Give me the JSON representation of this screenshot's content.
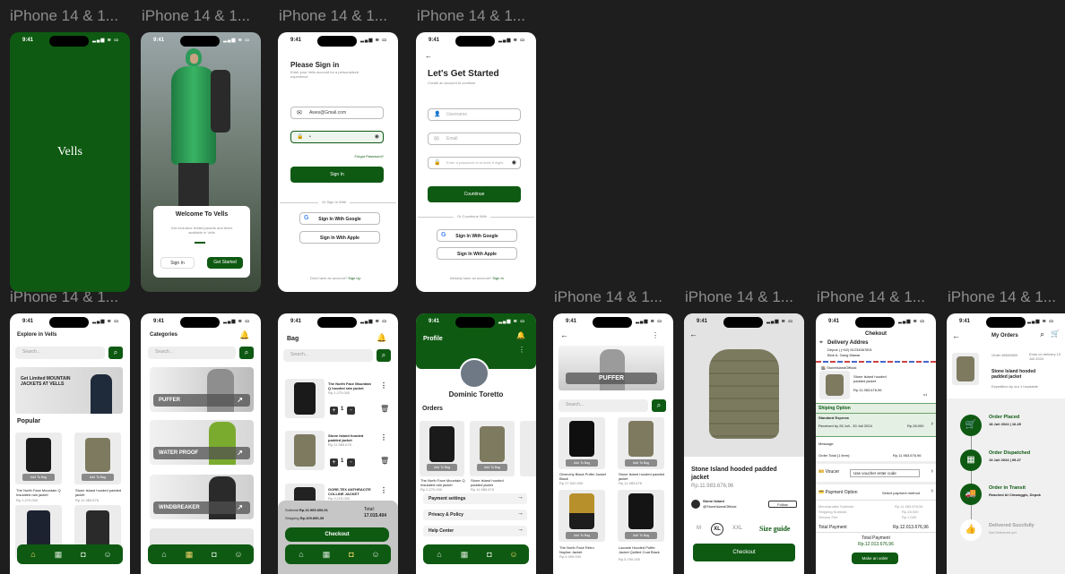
{
  "frame_label": "iPhone 14 & 1...",
  "status_time": "9:41",
  "status_icons": "▂▄▆ ≋ ▭",
  "splash": {
    "brand": "Vells"
  },
  "welcome": {
    "title": "Welcome To Vells",
    "subtitle": "Get exclusive limited jackets and items available in Vells",
    "sign_in": "Sign In",
    "get_started": "Get Started"
  },
  "signin": {
    "title": "Please Sign in",
    "subtitle": "Enter your Vells account for a personalized experience",
    "email": "Awes@Gmail.com",
    "password": "•",
    "forgot": "Forgot Password?",
    "button": "Sign In",
    "divider": "Or Sign In With",
    "google": "Sign In With Google",
    "apple": "Sign In With Apple",
    "footer": "Dont have an account?",
    "footer_link": "Sign Up"
  },
  "signup": {
    "title": "Let's Get Started",
    "subtitle": "Create an account to continue",
    "username": "Username",
    "email": "Email",
    "password": "Enter a password of at least 8 digits",
    "button": "Countinue",
    "divider": "Or Countinue With",
    "google": "Sign In With Google",
    "apple": "Sign In With Apple",
    "footer": "Already have an account?",
    "footer_link": "Sign In"
  },
  "explore": {
    "title": "Explore in Vells",
    "search": "Search...",
    "banner": "Get Limited MOUNTAIN JACKETS AT VELLS",
    "popular": "Popular",
    "add_to_bag": "Add To Bag",
    "p1_name": "The North Face Mountain Q Insulated rain jacket",
    "p1_price": "Rp.1.270.000",
    "p2_name": "Stone Island hooded padded jacket",
    "p2_price": "Rp.11.983.676"
  },
  "categories": {
    "title": "Categories",
    "search": "Search...",
    "items": [
      "PUFFER",
      "WATER PROOF",
      "WINDBREAKER"
    ]
  },
  "bag": {
    "title": "Bag",
    "search": "Search...",
    "item1": "The North Face Mountain Q hooded rain jacket",
    "item1_price": "Rp.1.270.000",
    "item2": "Stone Island hooded padded jacket",
    "item2_price": "Rp.11.983.676",
    "item3": "GORE-TEX ANTHRACITE COLLINE JACKET",
    "item3_price": "Rp.3.215.000",
    "qty": "1",
    "subtotal_label": "Subtotal",
    "subtotal": "Rp.16.905.800,91",
    "shipping_label": "Shipping",
    "shipping": "Rp.109.850,39",
    "total_label": "Total:",
    "total": "17.015.404",
    "checkout": "Checkout"
  },
  "profile": {
    "title": "Profile",
    "name": "Dominic Toretto",
    "orders": "Orders",
    "add_to_bag": "Add To Bag",
    "o1_name": "The North Face Mountain Q Insulated rain jacket",
    "o1_price": "Rp.1.270.000",
    "o2_name": "Stone Island hooded padded jacket",
    "o2_price": "Rp.11.983.676",
    "menu": [
      "Payment settings",
      "Privacy & Policy",
      "Help Center"
    ]
  },
  "puffer": {
    "banner": "PUFFER",
    "search": "Search...",
    "add_to_bag": "Add To Bag",
    "p1": "Givenchy Black Puffer Jacket Black",
    "p1_price": "Rp.27.000.000",
    "p2": "Stone Island hooded padded jacket",
    "p2_price": "Rp.11.983.676",
    "p3": "The North Face Retro Nuptse Jacket",
    "p3_price": "Rp.4.499.000",
    "p4": "Lacoste Hooded Puffer Jacket Quilted Coat Black",
    "p4_price": "Rp.5.700.000"
  },
  "detail": {
    "name": "Stone Island hooded padded jacket",
    "price": "Rp.11.983.676,96",
    "store": "Stone Island",
    "store_handle": "@StoneIslandOfficial",
    "follow": "Follow",
    "sizes": [
      "M",
      "XL",
      "XXL"
    ],
    "size_guide": "Size guide",
    "checkout": "Checkout"
  },
  "checkout": {
    "title": "Chekout",
    "address_title": "Delivery Addres",
    "address_line1": "Depok | (+62) 81234567891",
    "address_line2": "Blok A, Gang Mawar",
    "store": "StoneIslandOfficial",
    "item": "Stone Island hooded padded jacket",
    "item_qty": "Rp.11.983.676,96",
    "qty": "x1",
    "shipping_title": "Shiping Option",
    "shipping_method": "Standard Express",
    "shipping_eta": "Received by 28 Juli - 30 Juli 2024",
    "shipping_price": "Rp.28.000",
    "message": "Message:",
    "order_total_label": "Order Total (1 item):",
    "order_total": "Rp.11.983.676,96",
    "voucher": "Voucer",
    "voucher_placeholder": "Use voucher enter code",
    "payment": "Payment Option",
    "payment_select": "Select payment method",
    "merch_label": "Merchandise Subtotal",
    "merch": "Rp.11.983.676,96",
    "ship_sub_label": "Shipping Subtotal",
    "ship_sub": "Rp.28.000",
    "service_label": "Service Fee",
    "service": "Rp.1.000",
    "total_pay_label": "Total Payment",
    "total_pay": "Rp.12.013.676,96",
    "footer_label": "Total Payment",
    "footer_total": "Rp.12.013.676,96",
    "make_order": "Make an order"
  },
  "myorders": {
    "title": "My Orders",
    "item": "Stone Island hooded padded jacket",
    "order_id": "Order #8540650",
    "eta": "Ends on delivery 13 Juli 2024",
    "note": "Expedition by our 1 hoodable",
    "steps": [
      {
        "title": "Order Placed",
        "date": "18 Juli 2024",
        "time": "16.45"
      },
      {
        "title": "Order Dispatched",
        "date": "19 Juli 2024",
        "time": "09.47"
      },
      {
        "title": "Order in Transit",
        "date": "Reached At Cimanggis, Depok",
        "time": ""
      },
      {
        "title": "Delivered Succfully",
        "date": "Not Delivered yet",
        "time": ""
      }
    ]
  }
}
